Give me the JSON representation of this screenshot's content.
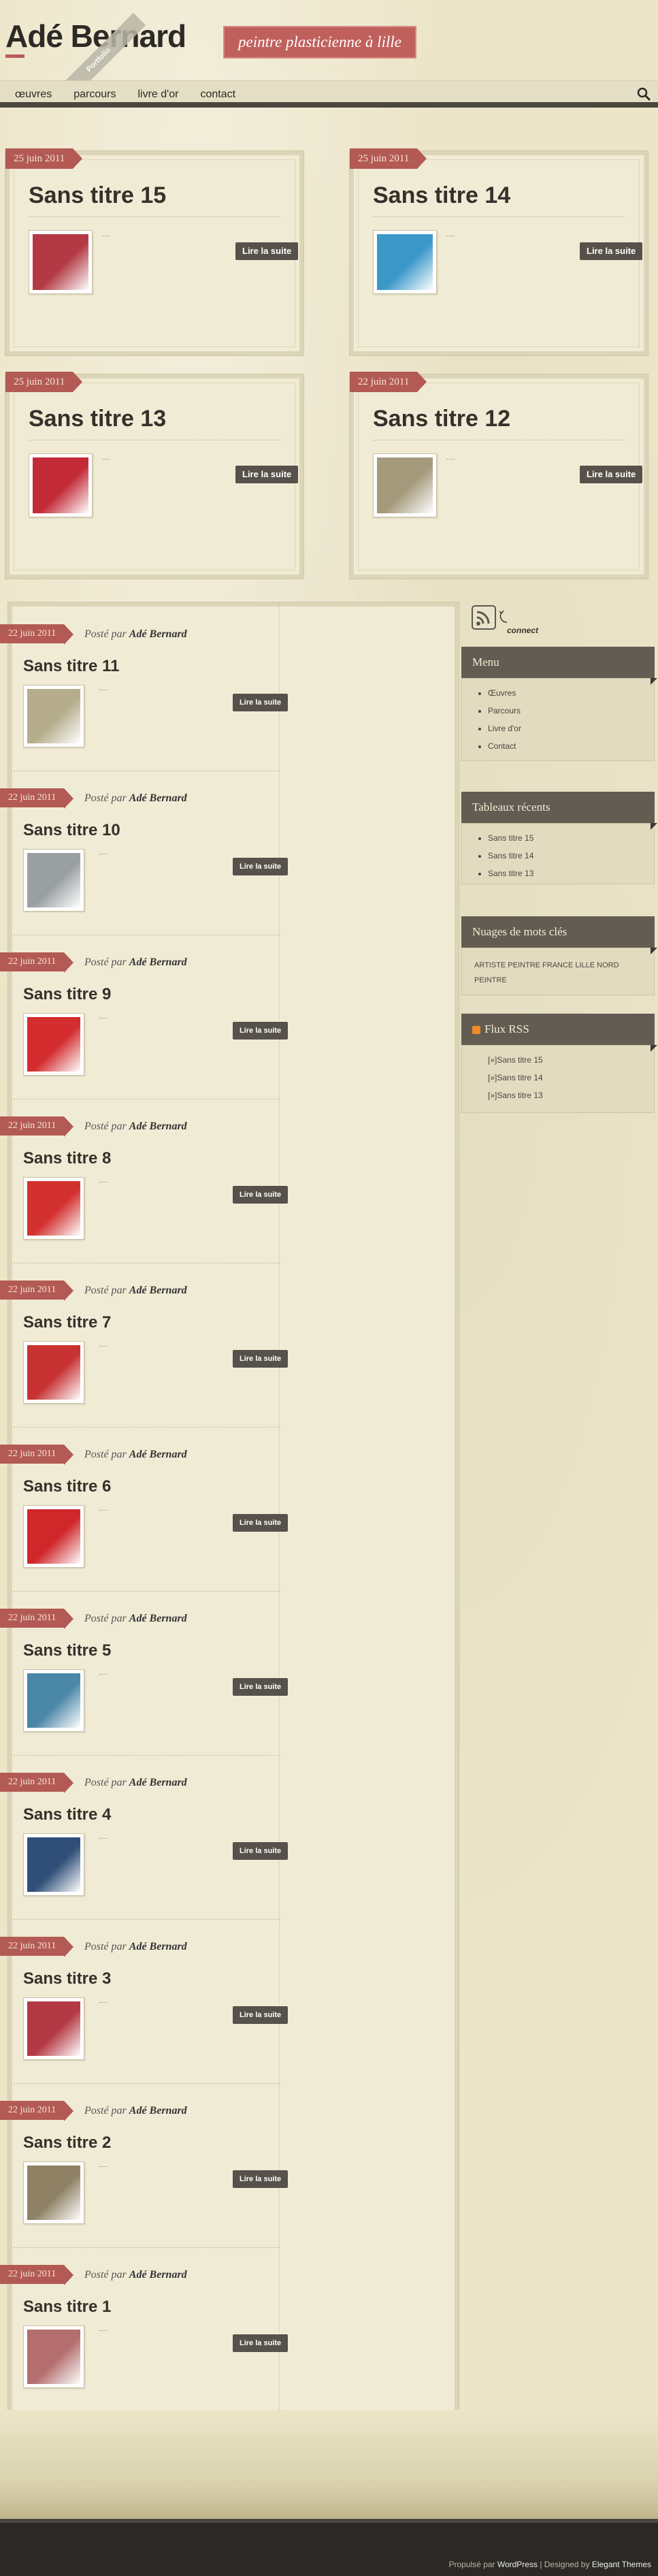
{
  "header": {
    "site_title": "Adé Bernard",
    "tagline": "peintre plasticienne à lille",
    "ribbon": "Portfolio"
  },
  "nav": {
    "items": [
      "œuvres",
      "parcours",
      "livre d'or",
      "contact"
    ]
  },
  "featured": [
    {
      "date": "25 juin 2011",
      "title": "Sans titre 15",
      "button": "Lire la suite",
      "color": "#b33a44"
    },
    {
      "date": "25 juin 2011",
      "title": "Sans titre 14",
      "button": "Lire la suite",
      "color": "#3b98c9"
    },
    {
      "date": "25 juin 2011",
      "title": "Sans titre 13",
      "button": "Lire la suite",
      "color": "#c22a36"
    },
    {
      "date": "22 juin 2011",
      "title": "Sans titre 12",
      "button": "Lire la suite",
      "color": "#a59a7c"
    }
  ],
  "posts": [
    {
      "date": "22 juin 2011",
      "posted_prefix": "Posté par",
      "author": "Adé Bernard",
      "title": "Sans titre 11",
      "button": "Lire la suite",
      "color": "#b6ad8c"
    },
    {
      "date": "22 juin 2011",
      "posted_prefix": "Posté par",
      "author": "Adé Bernard",
      "title": "Sans titre 10",
      "button": "Lire la suite",
      "color": "#9aa0a2"
    },
    {
      "date": "22 juin 2011",
      "posted_prefix": "Posté par",
      "author": "Adé Bernard",
      "title": "Sans titre 9",
      "button": "Lire la suite",
      "color": "#d42c2f"
    },
    {
      "date": "22 juin 2011",
      "posted_prefix": "Posté par",
      "author": "Adé Bernard",
      "title": "Sans titre 8",
      "button": "Lire la suite",
      "color": "#d2312f"
    },
    {
      "date": "22 juin 2011",
      "posted_prefix": "Posté par",
      "author": "Adé Bernard",
      "title": "Sans titre 7",
      "button": "Lire la suite",
      "color": "#c73232"
    },
    {
      "date": "22 juin 2011",
      "posted_prefix": "Posté par",
      "author": "Adé Bernard",
      "title": "Sans titre 6",
      "button": "Lire la suite",
      "color": "#d0272b"
    },
    {
      "date": "22 juin 2011",
      "posted_prefix": "Posté par",
      "author": "Adé Bernard",
      "title": "Sans titre 5",
      "button": "Lire la suite",
      "color": "#4a86a6"
    },
    {
      "date": "22 juin 2011",
      "posted_prefix": "Posté par",
      "author": "Adé Bernard",
      "title": "Sans titre 4",
      "button": "Lire la suite",
      "color": "#2f4f78"
    },
    {
      "date": "22 juin 2011",
      "posted_prefix": "Posté par",
      "author": "Adé Bernard",
      "title": "Sans titre 3",
      "button": "Lire la suite",
      "color": "#b33a44"
    },
    {
      "date": "22 juin 2011",
      "posted_prefix": "Posté par",
      "author": "Adé Bernard",
      "title": "Sans titre 2",
      "button": "Lire la suite",
      "color": "#8f8163"
    },
    {
      "date": "22 juin 2011",
      "posted_prefix": "Posté par",
      "author": "Adé Bernard",
      "title": "Sans titre 1",
      "button": "Lire la suite",
      "color": "#b46e6e"
    }
  ],
  "sidebar": {
    "connect_label": "connect",
    "menu": {
      "title": "Menu",
      "items": [
        "Œuvres",
        "Parcours",
        "Livre d'or",
        "Contact"
      ]
    },
    "recent": {
      "title": "Tableaux récents",
      "items": [
        "Sans titre 15",
        "Sans titre 14",
        "Sans titre 13"
      ]
    },
    "tags": {
      "title": "Nuages de mots clés",
      "text": "ARTISTE PEINTRE FRANCE LILLE NORD PEINTRE"
    },
    "rss": {
      "title": "Flux RSS",
      "items": [
        "[»]Sans titre 15",
        "[»]Sans titre 14",
        "[»]Sans titre 13"
      ]
    }
  },
  "footer": {
    "powered_prefix": "Propulsé par",
    "powered_link": "WordPress",
    "designed_prefix": "| Designed by",
    "designed_link": "Elegant Themes"
  }
}
